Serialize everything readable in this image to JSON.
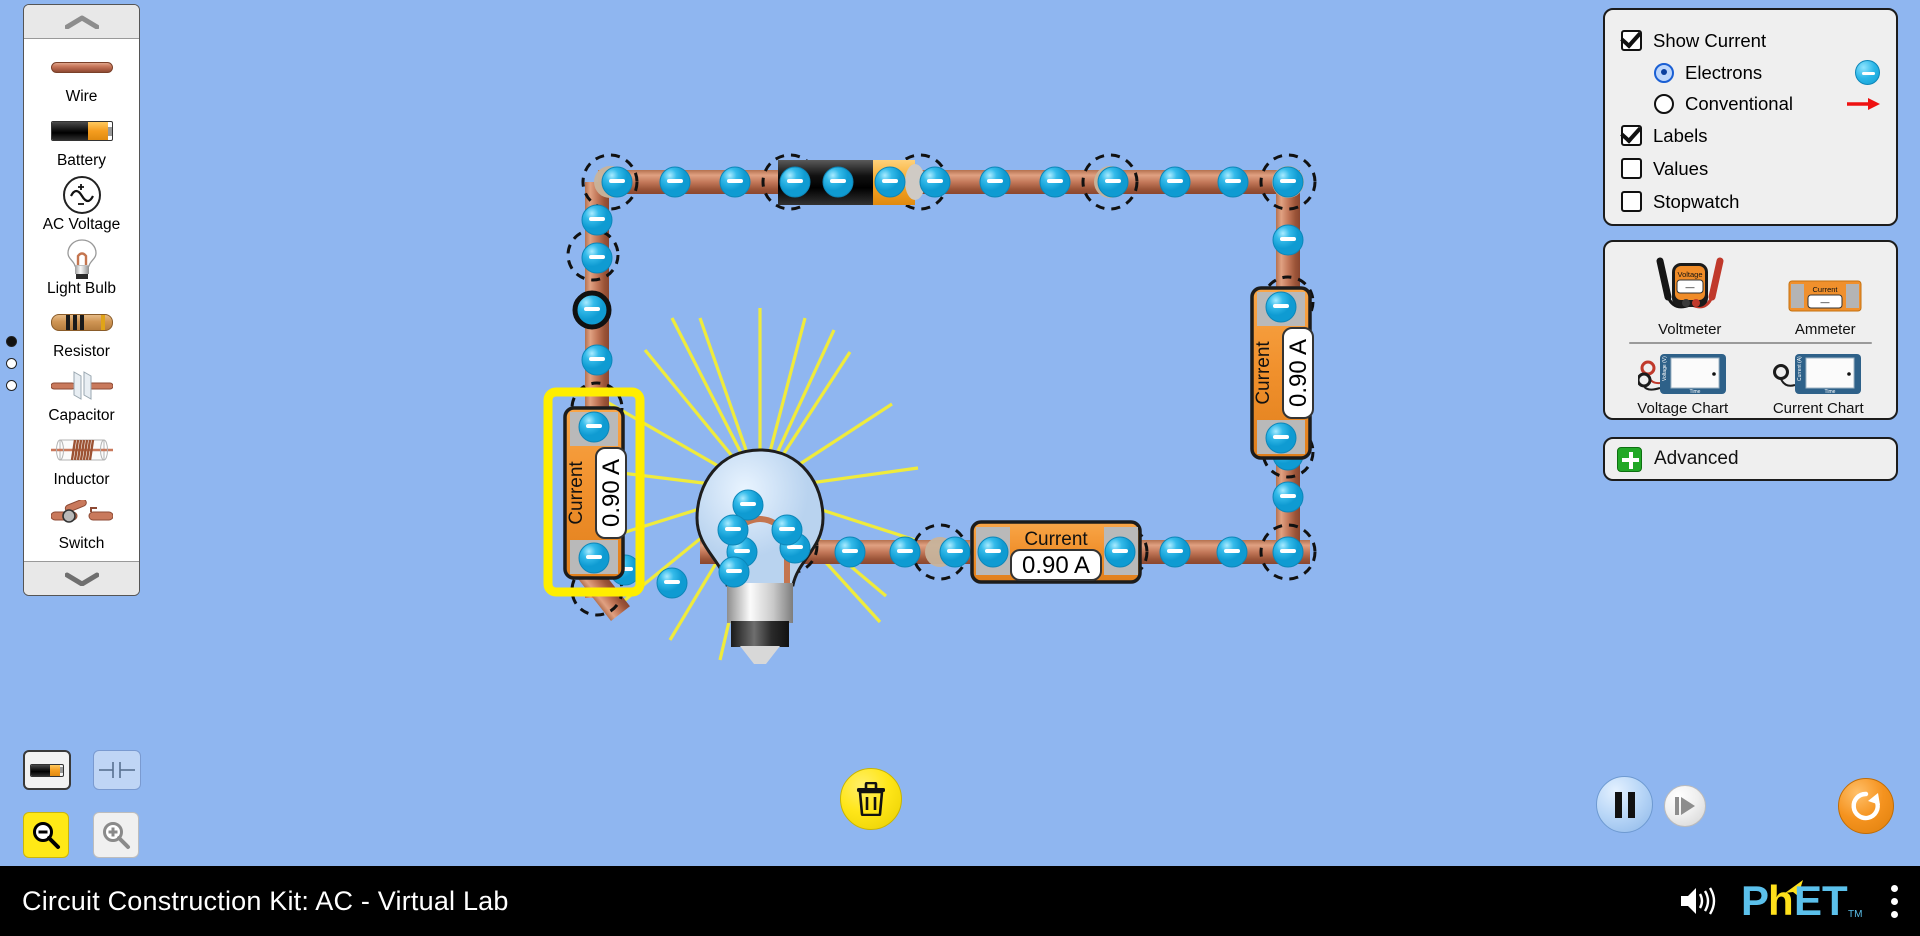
{
  "sim": {
    "title": "Circuit Construction Kit: AC - Virtual Lab",
    "background_color": "#8FB6F0"
  },
  "carousel": {
    "scroll_up": "scroll-up",
    "scroll_down": "scroll-down",
    "items": [
      {
        "label": "Wire",
        "icon": "wire-icon"
      },
      {
        "label": "Battery",
        "icon": "battery-icon"
      },
      {
        "label": "AC Voltage",
        "icon": "ac-voltage-icon"
      },
      {
        "label": "Light Bulb",
        "icon": "light-bulb-icon"
      },
      {
        "label": "Resistor",
        "icon": "resistor-icon"
      },
      {
        "label": "Capacitor",
        "icon": "capacitor-icon"
      },
      {
        "label": "Inductor",
        "icon": "inductor-icon"
      },
      {
        "label": "Switch",
        "icon": "switch-icon"
      }
    ]
  },
  "edge_radios": [
    {
      "selected": true
    },
    {
      "selected": false
    },
    {
      "selected": false
    }
  ],
  "view_buttons": {
    "battery_mode": "battery-view-icon",
    "schematic_mode": "schematic-view-icon",
    "zoom_out": "zoom-out-icon",
    "zoom_in": "zoom-in-icon",
    "zoom_out_selected": true
  },
  "display_panel": {
    "show_current": {
      "label": "Show Current",
      "checked": true
    },
    "current_type": [
      {
        "label": "Electrons",
        "selected": true,
        "indicator": "electron-icon"
      },
      {
        "label": "Conventional",
        "selected": false,
        "indicator": "red-arrow-icon"
      }
    ],
    "labels": {
      "label": "Labels",
      "checked": true
    },
    "values": {
      "label": "Values",
      "checked": false
    },
    "stopwatch": {
      "label": "Stopwatch",
      "checked": false
    }
  },
  "sensors_panel": {
    "voltmeter": {
      "label": "Voltmeter",
      "readout_title": "Voltage",
      "readout_value": "—"
    },
    "ammeter": {
      "label": "Ammeter",
      "readout_title": "Current",
      "readout_value": "—"
    },
    "voltage_chart": {
      "label": "Voltage Chart",
      "ylabel": "Voltage (V)",
      "xlabel": "Time"
    },
    "current_chart": {
      "label": "Current Chart",
      "ylabel": "Current (A)",
      "xlabel": "Time"
    }
  },
  "advanced": {
    "label": "Advanced",
    "expanded": false
  },
  "circuit": {
    "ammeters": [
      {
        "id": "ammeter-left",
        "title": "Current",
        "value": "0.90 A",
        "orientation": "vertical",
        "selected": true
      },
      {
        "id": "ammeter-right",
        "title": "Current",
        "value": "0.90 A",
        "orientation": "vertical",
        "selected": false
      },
      {
        "id": "ammeter-bottom",
        "title": "Current",
        "value": "0.90 A",
        "orientation": "horizontal",
        "selected": false
      }
    ],
    "light_bulb": {
      "lit": true
    },
    "battery": {
      "id": "battery"
    },
    "colors": {
      "wire": "#c07a57",
      "electron": "#2bb7e8",
      "ammeter_body": "#f0902c",
      "selection_highlight": "#ffee00"
    }
  },
  "trash_button": {
    "icon": "trash-icon"
  },
  "playback": {
    "pause": {
      "icon": "pause-icon",
      "active": true
    },
    "step_forward": {
      "icon": "step-forward-icon",
      "active": false
    },
    "reset_all": {
      "icon": "reset-icon"
    }
  },
  "bottom_bar": {
    "sound_icon": "sound-on-icon",
    "logo": {
      "p": "P",
      "h": "h",
      "et": "ET",
      "tm": "TM"
    },
    "menu_icon": "kebab-menu-icon"
  }
}
